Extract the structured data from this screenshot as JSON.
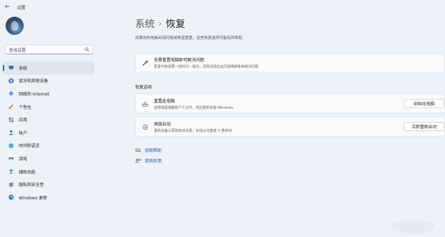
{
  "titlebar": {
    "back_icon": "back-arrow-icon",
    "title": "设置"
  },
  "search": {
    "placeholder": "查找设置",
    "icon": "search-icon"
  },
  "sidebar": {
    "items": [
      {
        "label": "系统",
        "icon": "system-display-icon",
        "active": true
      },
      {
        "label": "蓝牙和其他设备",
        "icon": "bluetooth-icon"
      },
      {
        "label": "网络和 Internet",
        "icon": "network-icon"
      },
      {
        "label": "个性化",
        "icon": "paintbrush-icon"
      },
      {
        "label": "应用",
        "icon": "apps-icon"
      },
      {
        "label": "帐户",
        "icon": "account-icon"
      },
      {
        "label": "时间和语言",
        "icon": "globe-clock-icon"
      },
      {
        "label": "游戏",
        "icon": "gamepad-icon"
      },
      {
        "label": "辅助功能",
        "icon": "accessibility-icon"
      },
      {
        "label": "隐私和安全性",
        "icon": "shield-icon"
      },
      {
        "label": "Windows 更新",
        "icon": "windows-update-icon"
      }
    ]
  },
  "main": {
    "breadcrumb_parent": "系统",
    "breadcrumb_sep": "›",
    "breadcrumb_current": "恢复",
    "subtitle": "如果你的电脑出现问题或希望重置，这些恢复选项可能有所帮助",
    "fix_card": {
      "title": "无需重置电脑即可解决问题",
      "desc": "重置可能需要一段时间 - 首先，请尝试通过运行疑难解答来解决问题",
      "icon": "wrench-icon"
    },
    "section_heading": "恢复选项",
    "reset_card": {
      "title": "重置此电脑",
      "desc": "选择保留或删除个人文件，然后重新安装 Windows",
      "button": "初始化电脑",
      "icon": "reset-pc-icon"
    },
    "advanced_card": {
      "title": "高级启动",
      "desc": "重启设备以更改启动设置，包括从光盘或 U 盘启动",
      "button": "立即重新启动",
      "icon": "advanced-startup-icon"
    },
    "help_link": "获取帮助",
    "feedback_link": "提供反馈"
  },
  "colors": {
    "accent": "#1a6fc9",
    "background": "#eef1f7",
    "card": "#f9fafc"
  }
}
